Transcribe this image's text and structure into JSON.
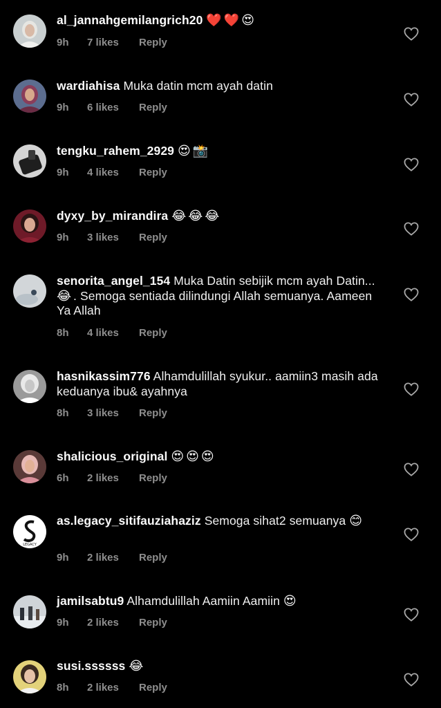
{
  "comments": [
    {
      "username": "al_jannahgemilangrich20",
      "text": "",
      "emoji": "❤️❤️😍",
      "time": "9h",
      "likes": "7 likes",
      "reply": "Reply"
    },
    {
      "username": "wardiahisa",
      "text": "Muka datin mcm ayah datin",
      "emoji": "",
      "time": "9h",
      "likes": "6 likes",
      "reply": "Reply"
    },
    {
      "username": "tengku_rahem_2929",
      "text": "",
      "emoji": "😍📸",
      "time": "9h",
      "likes": "4 likes",
      "reply": "Reply"
    },
    {
      "username": "dyxy_by_mirandira",
      "text": "",
      "emoji": "😂😂😂",
      "time": "9h",
      "likes": "3 likes",
      "reply": "Reply"
    },
    {
      "username": "senorita_angel_154",
      "text": "Muka Datin sebijik mcm ayah Datin...",
      "emoji": "😂",
      "text2": ". Semoga sentiada dilindungi Allah semuanya. Aameen Ya Allah",
      "time": "8h",
      "likes": "4 likes",
      "reply": "Reply"
    },
    {
      "username": "hasnikassim776",
      "text": "Alhamdulillah syukur.. aamiin3 masih ada keduanya ibu& ayahnya",
      "emoji": "",
      "time": "8h",
      "likes": "3 likes",
      "reply": "Reply"
    },
    {
      "username": "shalicious_original",
      "text": "",
      "emoji": "😍😍😍",
      "time": "6h",
      "likes": "2 likes",
      "reply": "Reply"
    },
    {
      "username": "as.legacy_sitifauziahaziz",
      "text": "Semoga sihat2 semuanya",
      "emoji": "😊",
      "time": "9h",
      "likes": "2 likes",
      "reply": "Reply"
    },
    {
      "username": "jamilsabtu9",
      "text": "Alhamdulillah Aamiin Aamiin",
      "emoji": "😍",
      "time": "9h",
      "likes": "2 likes",
      "reply": "Reply"
    },
    {
      "username": "susi.ssssss",
      "text": "",
      "emoji": "😂",
      "time": "8h",
      "likes": "2 likes",
      "reply": "Reply"
    }
  ],
  "avatars": {
    "legacy_label": "LEGACY"
  },
  "colors": {
    "background": "#000000",
    "username": "#fafafa",
    "meta": "#8e8e8e",
    "heart_outline": "#a8a8a8"
  }
}
